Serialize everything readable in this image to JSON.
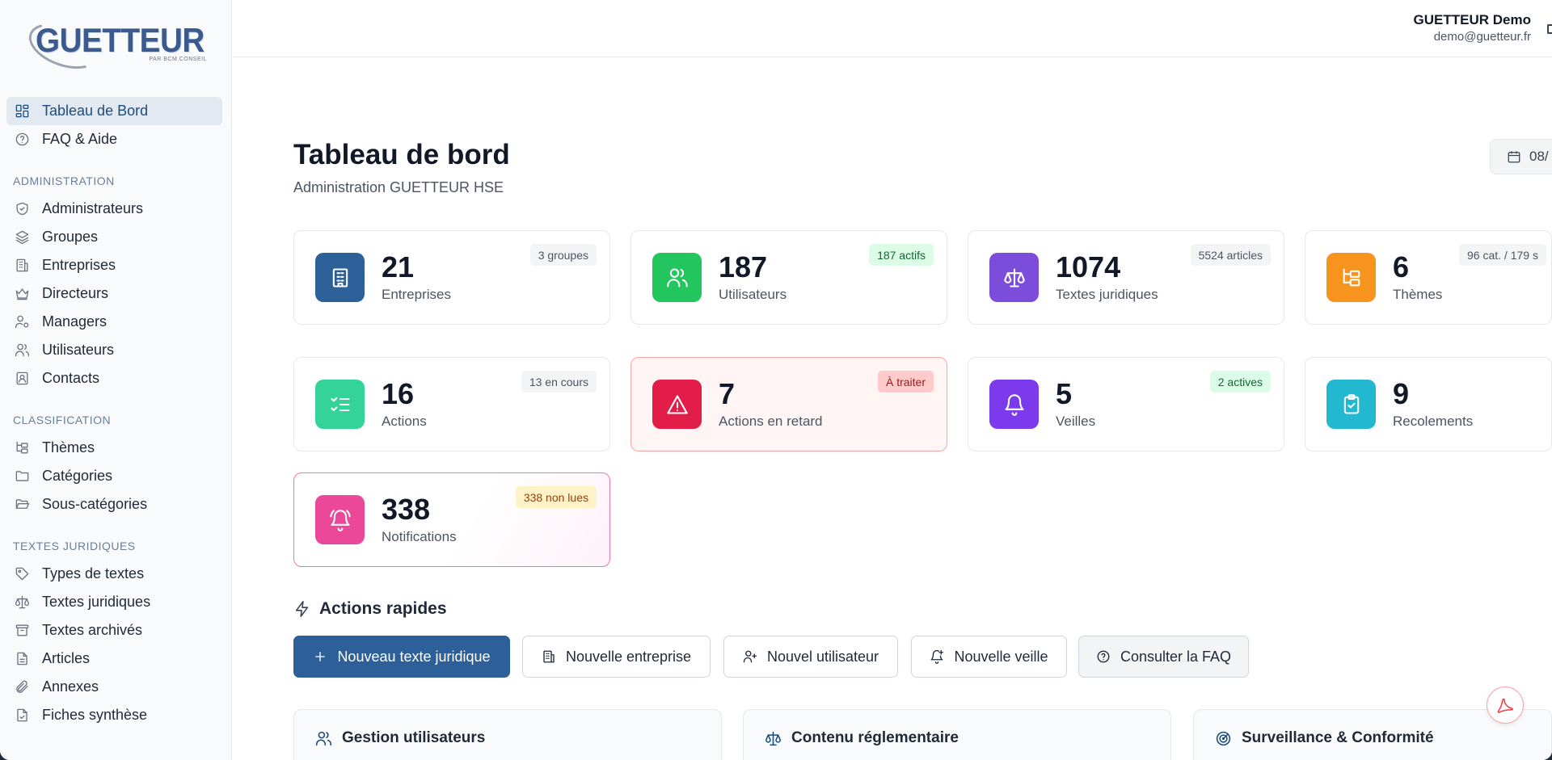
{
  "logo": {
    "brand": "GUETTEUR",
    "sub": "PAR BCM CONSEIL"
  },
  "sidebar": {
    "top_items": [
      {
        "label": "Tableau de Bord",
        "icon": "grid-icon",
        "active": true
      },
      {
        "label": "FAQ & Aide",
        "icon": "help-circle-icon"
      }
    ],
    "sections": [
      {
        "title": "ADMINISTRATION",
        "items": [
          {
            "label": "Administrateurs",
            "icon": "shield-icon"
          },
          {
            "label": "Groupes",
            "icon": "layers-icon"
          },
          {
            "label": "Entreprises",
            "icon": "building-icon"
          },
          {
            "label": "Directeurs",
            "icon": "crown-icon"
          },
          {
            "label": "Managers",
            "icon": "user-cog-icon"
          },
          {
            "label": "Utilisateurs",
            "icon": "users-icon"
          },
          {
            "label": "Contacts",
            "icon": "contact-icon"
          }
        ]
      },
      {
        "title": "CLASSIFICATION",
        "items": [
          {
            "label": "Thèmes",
            "icon": "folder-tree-icon"
          },
          {
            "label": "Catégories",
            "icon": "folder-icon"
          },
          {
            "label": "Sous-catégories",
            "icon": "folder-open-icon"
          }
        ]
      },
      {
        "title": "TEXTES JURIDIQUES",
        "items": [
          {
            "label": "Types de textes",
            "icon": "tag-icon"
          },
          {
            "label": "Textes juridiques",
            "icon": "scale-icon"
          },
          {
            "label": "Textes archivés",
            "icon": "archive-icon"
          },
          {
            "label": "Articles",
            "icon": "file-text-icon"
          },
          {
            "label": "Annexes",
            "icon": "paperclip-icon"
          },
          {
            "label": "Fiches synthèse",
            "icon": "file-check-icon"
          }
        ]
      }
    ]
  },
  "user": {
    "name": "GUETTEUR Demo",
    "email": "demo@guetteur.fr"
  },
  "page": {
    "title": "Tableau de bord",
    "subtitle": "Administration GUETTEUR HSE",
    "date": "08/"
  },
  "stats": [
    {
      "value": "21",
      "label": "Entreprises",
      "badge": "3 groupes",
      "color": "#2d5f98"
    },
    {
      "value": "187",
      "label": "Utilisateurs",
      "badge": "187 actifs",
      "color": "#22c55e"
    },
    {
      "value": "1074",
      "label": "Textes juridiques",
      "badge": "5524 articles",
      "color": "#7c4ddb"
    },
    {
      "value": "6",
      "label": "Thèmes",
      "badge": "96 cat. / 179 s",
      "color": "#f7941d"
    },
    {
      "value": "16",
      "label": "Actions",
      "badge": "13 en cours",
      "color": "#34d399"
    },
    {
      "value": "7",
      "label": "Actions en retard",
      "badge": "À traiter",
      "color": "#e11d48"
    },
    {
      "value": "5",
      "label": "Veilles",
      "badge": "2 actives",
      "color": "#7c3aed"
    },
    {
      "value": "9",
      "label": "Recolements",
      "badge": "",
      "color": "#22b8cf"
    },
    {
      "value": "338",
      "label": "Notifications",
      "badge": "338 non lues",
      "color": "#ec4899"
    }
  ],
  "quick_actions": {
    "title": "Actions rapides",
    "buttons": [
      {
        "label": "Nouveau texte juridique"
      },
      {
        "label": "Nouvelle entreprise"
      },
      {
        "label": "Nouvel utilisateur"
      },
      {
        "label": "Nouvelle veille"
      },
      {
        "label": "Consulter la FAQ"
      }
    ]
  },
  "panels": [
    {
      "title": "Gestion utilisateurs"
    },
    {
      "title": "Contenu réglementaire"
    },
    {
      "title": "Surveillance & Conformité"
    }
  ]
}
